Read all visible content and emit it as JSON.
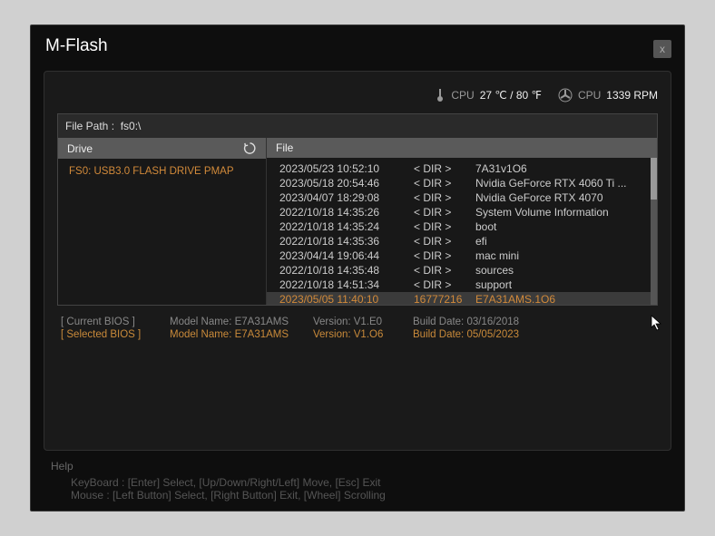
{
  "title": "M-Flash",
  "status": {
    "cpu_temp_label": "CPU",
    "cpu_temp_val": "27 ℃ / 80 ℉",
    "cpu_fan_label": "CPU",
    "cpu_fan_val": "1339 RPM"
  },
  "path": {
    "label": "File Path :",
    "value": "fs0:\\"
  },
  "headers": {
    "drive": "Drive",
    "file": "File"
  },
  "drives": [
    {
      "label": "FS0: USB3.0 FLASH DRIVE PMAP"
    }
  ],
  "files": [
    {
      "date": "2023/05/23 10:52:10",
      "dir": "< DIR >",
      "name": "7A31v1O6"
    },
    {
      "date": "2023/05/18 20:54:46",
      "dir": "< DIR >",
      "name": "Nvidia GeForce RTX 4060 Ti ..."
    },
    {
      "date": "2023/04/07 18:29:08",
      "dir": "< DIR >",
      "name": "Nvidia GeForce RTX 4070"
    },
    {
      "date": "2022/10/18 14:35:26",
      "dir": "< DIR >",
      "name": "System Volume Information"
    },
    {
      "date": "2022/10/18 14:35:24",
      "dir": "< DIR >",
      "name": "boot"
    },
    {
      "date": "2022/10/18 14:35:36",
      "dir": "< DIR >",
      "name": "efi"
    },
    {
      "date": "2023/04/14 19:06:44",
      "dir": "< DIR >",
      "name": "mac mini"
    },
    {
      "date": "2022/10/18 14:35:48",
      "dir": "< DIR >",
      "name": "sources"
    },
    {
      "date": "2022/10/18 14:51:34",
      "dir": "< DIR >",
      "name": "support"
    },
    {
      "date": "2023/05/05 11:40:10",
      "dir": "16777216",
      "name": "E7A31AMS.1O6",
      "selected": true
    }
  ],
  "bios": {
    "current": {
      "tag": "[ Current BIOS   ]",
      "model": "Model Name: E7A31AMS",
      "version": "Version: V1.E0",
      "build": "Build Date: 03/16/2018"
    },
    "selected": {
      "tag": "[ Selected BIOS ]",
      "model": "Model Name: E7A31AMS",
      "version": "Version: V1.O6",
      "build": "Build Date: 05/05/2023"
    }
  },
  "help": {
    "title": "Help",
    "keyboard": "KeyBoard :   [Enter]  Select,    [Up/Down/Right/Left]  Move,    [Esc]  Exit",
    "mouse": "Mouse      :   [Left Button]  Select,    [Right Button]  Exit,    [Wheel]  Scrolling"
  }
}
